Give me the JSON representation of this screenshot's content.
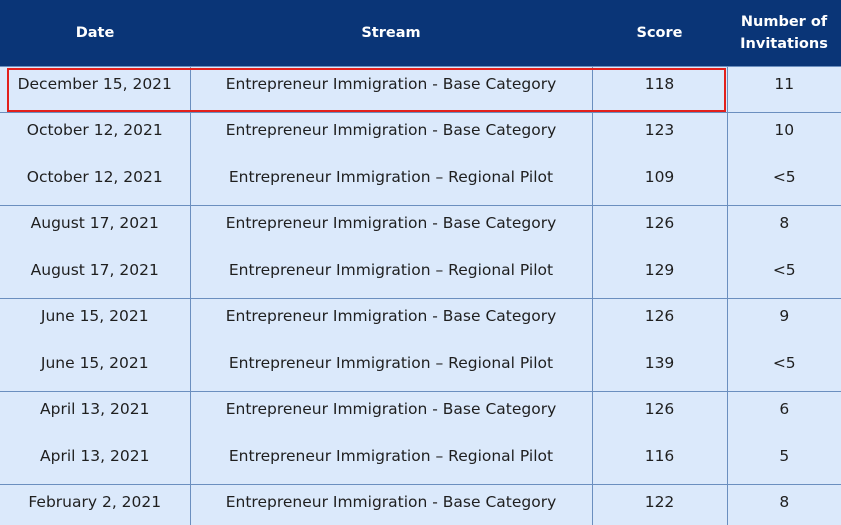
{
  "headers": {
    "date": "Date",
    "stream": "Stream",
    "score": "Score",
    "invitations": "Number of\nInvitations"
  },
  "rows": [
    {
      "date": "December 15, 2021",
      "stream": "Entrepreneur Immigration - Base Category",
      "score": "118",
      "invitations": "11"
    },
    {
      "date": "October 12, 2021",
      "stream": "Entrepreneur Immigration - Base Category",
      "score": "123",
      "invitations": "10"
    },
    {
      "date": "October 12, 2021",
      "stream": "Entrepreneur Immigration – Regional Pilot",
      "score": "109",
      "invitations": "<5"
    },
    {
      "date": "August 17, 2021",
      "stream": "Entrepreneur Immigration - Base Category",
      "score": "126",
      "invitations": "8"
    },
    {
      "date": "August 17, 2021",
      "stream": "Entrepreneur Immigration – Regional Pilot",
      "score": "129",
      "invitations": "<5"
    },
    {
      "date": "June 15, 2021",
      "stream": "Entrepreneur Immigration - Base Category",
      "score": "126",
      "invitations": "9"
    },
    {
      "date": "June 15, 2021",
      "stream": "Entrepreneur Immigration – Regional Pilot",
      "score": "139",
      "invitations": "<5"
    },
    {
      "date": "April 13, 2021",
      "stream": "Entrepreneur Immigration - Base Category",
      "score": "126",
      "invitations": "6"
    },
    {
      "date": "April 13, 2021",
      "stream": "Entrepreneur Immigration – Regional Pilot",
      "score": "116",
      "invitations": "5"
    },
    {
      "date": "February 2, 2021",
      "stream": "Entrepreneur Immigration - Base Category",
      "score": "122",
      "invitations": "8"
    }
  ],
  "highlighted_row": 0,
  "colors": {
    "header_bg": "#0a3577",
    "row_bg": "#dbe9fb",
    "highlight_border": "#e2201c"
  }
}
